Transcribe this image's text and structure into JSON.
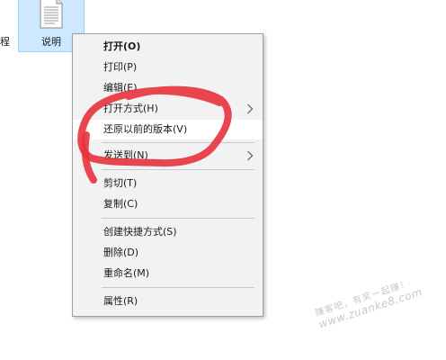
{
  "desktop": {
    "left_fragment": "程",
    "file": {
      "label": "说明",
      "icon": "text-document-icon"
    }
  },
  "context_menu": {
    "items": [
      {
        "label": "打开(O)",
        "bold": true
      },
      {
        "label": "打印(P)"
      },
      {
        "label": "编辑(E)"
      },
      {
        "label": "打开方式(H)",
        "submenu": true
      },
      {
        "label": "还原以前的版本(V)",
        "highlighted": true
      },
      {
        "label": "发送到(N)",
        "submenu": true
      },
      {
        "label": "剪切(T)"
      },
      {
        "label": "复制(C)"
      },
      {
        "label": "创建快捷方式(S)"
      },
      {
        "label": "删除(D)"
      },
      {
        "label": "重命名(M)"
      },
      {
        "label": "属性(R)"
      }
    ],
    "submenu_icon": "chevron-right-icon"
  },
  "annotation": {
    "color": "#e8323c",
    "shape": "freehand-circle"
  },
  "watermark": {
    "line1": "赚客吧，有奖一起赚！",
    "line2": "www.zuanke8.com"
  },
  "colors": {
    "menu_bg": "#f2f2f2",
    "menu_hover": "#ffffff",
    "selection_bg": "#cde8ff",
    "selection_border": "#99d1ff"
  }
}
